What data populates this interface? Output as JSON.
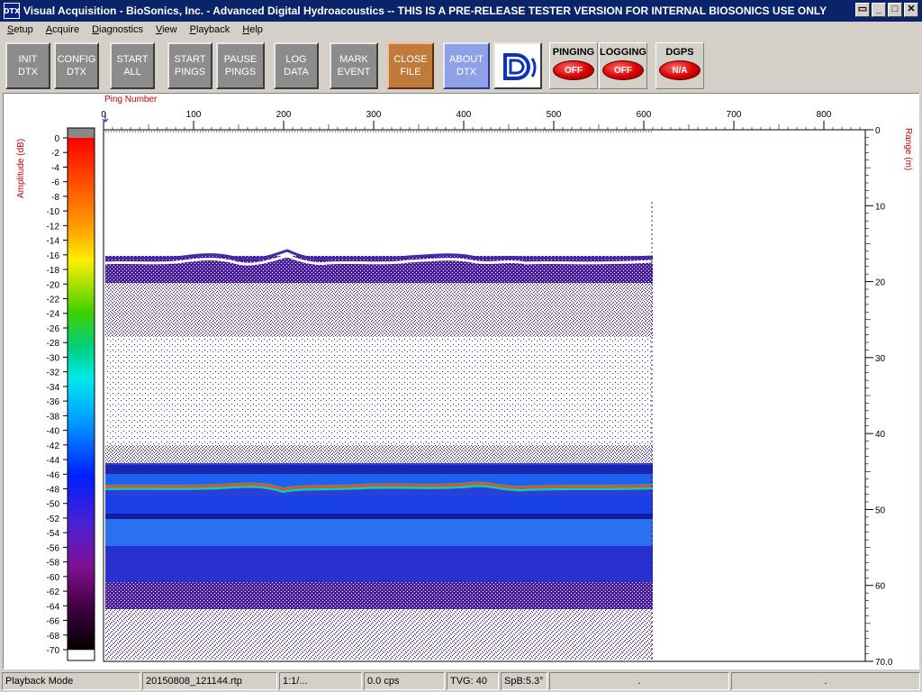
{
  "window": {
    "icon_text": "DTX",
    "title": "Visual Acquisition  -  BioSonics, Inc.  -  Advanced Digital Hydroacoustics  -- THIS IS A PRE-RELEASE TESTER VERSION FOR INTERNAL BIOSONICS USE ONLY",
    "controls": [
      "restore-icon",
      "minimize-icon",
      "maximize-icon",
      "close-icon"
    ]
  },
  "menu": {
    "items": [
      {
        "label": "Setup",
        "accel": "S"
      },
      {
        "label": "Acquire",
        "accel": "A"
      },
      {
        "label": "Diagnostics",
        "accel": "D"
      },
      {
        "label": "View",
        "accel": "V"
      },
      {
        "label": "Playback",
        "accel": "P"
      },
      {
        "label": "Help",
        "accel": "H"
      }
    ]
  },
  "toolbar": {
    "init_dtx": "INIT\nDTX",
    "config_dtx": "CONFIG\nDTX",
    "start_all": "START\nALL",
    "start_pings": "START\nPINGS",
    "pause_pings": "PAUSE\nPINGS",
    "log_data": "LOG\nDATA",
    "mark_event": "MARK\nEVENT",
    "close_file": "CLOSE\nFILE",
    "about_dtx": "ABOUT\nDTX",
    "logo_icon": "biosonics-logo-icon",
    "pinging": {
      "title": "PINGING",
      "state": "OFF"
    },
    "logging": {
      "title": "LOGGING",
      "state": "OFF"
    },
    "dgps": {
      "title": "DGPS",
      "state": "N/A"
    }
  },
  "echogram": {
    "x_axis_label": "Ping Number",
    "x_ticks": [
      "0",
      "100",
      "200",
      "300",
      "400",
      "500",
      "600",
      "700",
      "800"
    ],
    "y_axis_label": "Range (m)",
    "y_ticks": [
      "0",
      "10",
      "20",
      "30",
      "40",
      "50",
      "60",
      "70.0"
    ],
    "colorbar_label": "Amplitude (dB)",
    "colorbar_ticks": [
      "0",
      "-2",
      "-4",
      "-6",
      "-8",
      "-10",
      "-12",
      "-14",
      "-16",
      "-18",
      "-20",
      "-22",
      "-24",
      "-26",
      "-28",
      "-30",
      "-32",
      "-34",
      "-36",
      "-38",
      "-40",
      "-42",
      "-44",
      "-46",
      "-48",
      "-50",
      "-52",
      "-54",
      "-56",
      "-58",
      "-60",
      "-62",
      "-64",
      "-66",
      "-68",
      "-70"
    ],
    "colors": {
      "axis_label": "#c00000",
      "surface_line": "#4a2aa0",
      "bottom_line": "#e05020"
    }
  },
  "statusbar": {
    "mode": "Playback Mode",
    "file": "20150808_121144.rtp",
    "ratio": "1:1/...",
    "cps": "0.0 cps",
    "tvg": "TVG: 40",
    "spb": "SpB:5.3°",
    "field7": ".",
    "field8": "."
  }
}
